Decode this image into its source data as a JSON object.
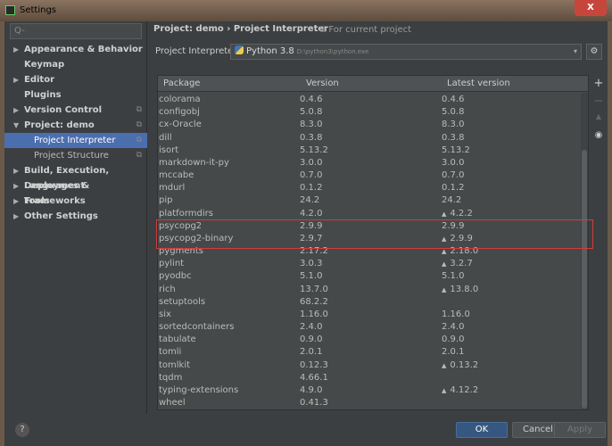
{
  "window": {
    "title": "Settings",
    "close": "X"
  },
  "sidebar": {
    "search_placeholder": "Q-",
    "items": [
      {
        "label": "Appearance & Behavior",
        "arrow": "▶"
      },
      {
        "label": "Keymap",
        "arrow": ""
      },
      {
        "label": "Editor",
        "arrow": "▶"
      },
      {
        "label": "Plugins",
        "arrow": ""
      },
      {
        "label": "Version Control",
        "arrow": "▶",
        "copy": "⧉"
      },
      {
        "label": "Project: demo",
        "arrow": "▼",
        "copy": "⧉"
      },
      {
        "label": "Project Interpreter",
        "sub": true,
        "selected": true,
        "copy": "⧉"
      },
      {
        "label": "Project Structure",
        "sub": true,
        "copy": "⧉"
      },
      {
        "label": "Build, Execution, Deployment",
        "arrow": "▶"
      },
      {
        "label": "Languages & Frameworks",
        "arrow": "▶"
      },
      {
        "label": "Tools",
        "arrow": "▶"
      },
      {
        "label": "Other Settings",
        "arrow": "▶"
      }
    ]
  },
  "header": {
    "breadcrumb": "Project: demo  ›  Project Interpreter",
    "for_current": "⧉ For current project"
  },
  "interpreter": {
    "label": "Project Interpreter:",
    "name": "Python 3.8",
    "path": "D:\\python3\\python.exe",
    "dropdown": "▾",
    "gear": "⚙"
  },
  "table": {
    "headers": [
      "Package",
      "Version",
      "Latest version"
    ],
    "upgrade_icon": "▲",
    "rows": [
      [
        "colorama",
        "0.4.6",
        "0.4.6",
        false
      ],
      [
        "configobj",
        "5.0.8",
        "5.0.8",
        false
      ],
      [
        "cx-Oracle",
        "8.3.0",
        "8.3.0",
        false
      ],
      [
        "dill",
        "0.3.8",
        "0.3.8",
        false
      ],
      [
        "isort",
        "5.13.2",
        "5.13.2",
        false
      ],
      [
        "markdown-it-py",
        "3.0.0",
        "3.0.0",
        false
      ],
      [
        "mccabe",
        "0.7.0",
        "0.7.0",
        false
      ],
      [
        "mdurl",
        "0.1.2",
        "0.1.2",
        false
      ],
      [
        "pip",
        "24.2",
        "24.2",
        false
      ],
      [
        "platformdirs",
        "4.2.0",
        "4.2.2",
        true
      ],
      [
        "psycopg2",
        "2.9.9",
        "2.9.9",
        false
      ],
      [
        "psycopg2-binary",
        "2.9.7",
        "2.9.9",
        true
      ],
      [
        "pygments",
        "2.17.2",
        "2.18.0",
        true
      ],
      [
        "pylint",
        "3.0.3",
        "3.2.7",
        true
      ],
      [
        "pyodbc",
        "5.1.0",
        "5.1.0",
        false
      ],
      [
        "rich",
        "13.7.0",
        "13.8.0",
        true
      ],
      [
        "setuptools",
        "68.2.2",
        "",
        false
      ],
      [
        "six",
        "1.16.0",
        "1.16.0",
        false
      ],
      [
        "sortedcontainers",
        "2.4.0",
        "2.4.0",
        false
      ],
      [
        "tabulate",
        "0.9.0",
        "0.9.0",
        false
      ],
      [
        "tomli",
        "2.0.1",
        "2.0.1",
        false
      ],
      [
        "tomlkit",
        "0.12.3",
        "0.13.2",
        true
      ],
      [
        "tqdm",
        "4.66.1",
        "",
        false
      ],
      [
        "typing-extensions",
        "4.9.0",
        "4.12.2",
        true
      ],
      [
        "wheel",
        "0.41.3",
        "",
        false
      ]
    ]
  },
  "tools": {
    "add": "+",
    "remove": "−",
    "upgrade": "▲",
    "show": "◉"
  },
  "footer": {
    "help": "?",
    "ok": "OK",
    "cancel": "Cancel",
    "apply": "Apply"
  },
  "colors": {
    "selection": "#4b6eaf",
    "highlight_box": "#d23c3c",
    "ok_button": "#365880"
  }
}
